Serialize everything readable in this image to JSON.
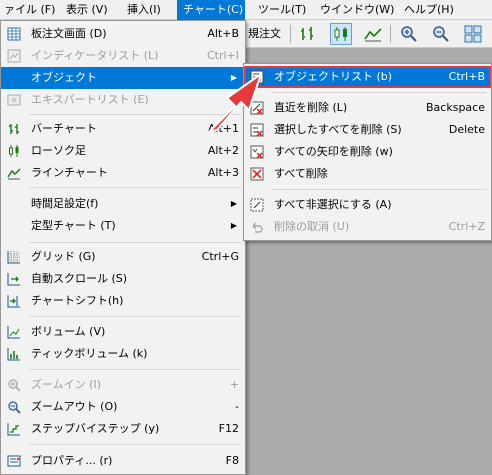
{
  "menubar": {
    "items": [
      {
        "label": "ァイル (F)"
      },
      {
        "label": "表示 (V)"
      },
      {
        "label": "挿入(I)"
      },
      {
        "label": "チャート(C)"
      },
      {
        "label": "ツール(T)"
      },
      {
        "label": "ウインドウ(W)"
      },
      {
        "label": "ヘルプ(H)"
      }
    ]
  },
  "toolbar": {
    "partial_text": "規注文"
  },
  "chart_menu": {
    "items": [
      {
        "label": "板注文画面 (D)",
        "shortcut": "Alt+B",
        "icon": "order-board-icon",
        "disabled": false
      },
      {
        "label": "インディケータリスト (L)",
        "shortcut": "Ctrl+I",
        "icon": "indicator-list-icon",
        "disabled": true
      },
      {
        "label": "オブジェクト",
        "shortcut": "",
        "icon": "",
        "disabled": false,
        "has_submenu": true
      },
      {
        "label": "エキスパートリスト (E)",
        "shortcut": "",
        "icon": "expert-list-icon",
        "disabled": true
      },
      {
        "label": "バーチャート",
        "shortcut": "Alt+1",
        "icon": "bar-chart-icon",
        "disabled": false
      },
      {
        "label": "ローソク足",
        "shortcut": "Alt+2",
        "icon": "candlestick-icon",
        "disabled": false
      },
      {
        "label": "ラインチャート",
        "shortcut": "Alt+3",
        "icon": "line-chart-icon",
        "disabled": false
      },
      {
        "label": "時間足設定(f)",
        "shortcut": "",
        "icon": "",
        "disabled": false,
        "has_submenu": true
      },
      {
        "label": "定型チャート (T)",
        "shortcut": "",
        "icon": "",
        "disabled": false,
        "has_submenu": true
      },
      {
        "label": "グリッド (G)",
        "shortcut": "Ctrl+G",
        "icon": "grid-icon",
        "disabled": false
      },
      {
        "label": "自動スクロール (S)",
        "shortcut": "",
        "icon": "auto-scroll-icon",
        "disabled": false
      },
      {
        "label": "チャートシフト(h)",
        "shortcut": "",
        "icon": "chart-shift-icon",
        "disabled": false
      },
      {
        "label": "ボリューム (V)",
        "shortcut": "",
        "icon": "volume-icon",
        "disabled": false
      },
      {
        "label": "ティックボリューム (k)",
        "shortcut": "",
        "icon": "tick-volume-icon",
        "disabled": false
      },
      {
        "label": "ズームイン (I)",
        "shortcut": "+",
        "icon": "zoom-in-icon",
        "disabled": true
      },
      {
        "label": "ズームアウト (O)",
        "shortcut": "-",
        "icon": "zoom-out-icon",
        "disabled": false
      },
      {
        "label": "ステップバイステップ (y)",
        "shortcut": "F12",
        "icon": "step-by-step-icon",
        "disabled": false
      },
      {
        "label": "プロパティ... (r)",
        "shortcut": "F8",
        "icon": "properties-icon",
        "disabled": false
      }
    ]
  },
  "object_submenu": {
    "items": [
      {
        "label": "オブジェクトリスト (b)",
        "shortcut": "Ctrl+B",
        "icon": "object-list-icon",
        "disabled": false,
        "highlighted": true
      },
      {
        "label": "直近を削除 (L)",
        "shortcut": "Backspace",
        "icon": "delete-last-icon",
        "disabled": false
      },
      {
        "label": "選択したすべてを削除 (S)",
        "shortcut": "Delete",
        "icon": "delete-selected-icon",
        "disabled": false
      },
      {
        "label": "すべての矢印を削除 (w)",
        "shortcut": "",
        "icon": "delete-arrows-icon",
        "disabled": false
      },
      {
        "label": "すべて削除",
        "shortcut": "",
        "icon": "delete-all-icon",
        "disabled": false
      },
      {
        "label": "すべて非選択にする (A)",
        "shortcut": "",
        "icon": "unselect-all-icon",
        "disabled": false
      },
      {
        "label": "削除の取消 (U)",
        "shortcut": "Ctrl+Z",
        "icon": "undo-delete-icon",
        "disabled": true
      }
    ]
  },
  "colors": {
    "highlight": "#0078d7",
    "callout": "#e63a3a",
    "disabled_text": "#9d9d9d",
    "chart_background": "#ababab"
  }
}
